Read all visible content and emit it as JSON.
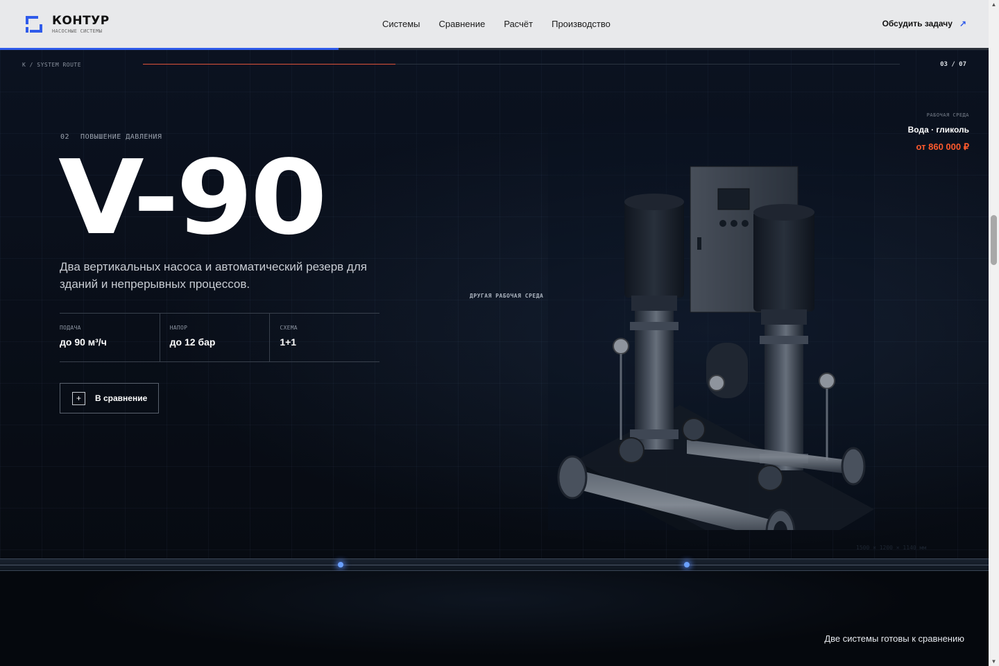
{
  "header": {
    "brand": "КОНТУР",
    "brand_sub": "НАСОСНЫЕ СИСТЕМЫ",
    "nav": [
      "Системы",
      "Сравнение",
      "Расчёт",
      "Производство"
    ],
    "cta_label": "Обсудить задачу",
    "cta_icon": "arrow-up-right-icon",
    "scroll_progress": 0.34,
    "accent": "#2f5bea"
  },
  "route": {
    "label": "K / SYSTEM ROUTE",
    "counter": "03 / 07",
    "accent": "#e0543a"
  },
  "hero": {
    "index": "02",
    "category": "ПОВЫШЕНИЕ ДАВЛЕНИЯ",
    "title": "V-90",
    "lead": "Два вертикальных насоса и автоматический резерв для зданий и непрерывных процессов.",
    "specs": [
      {
        "label": "ПОДАЧА",
        "value": "до 90 м³/ч"
      },
      {
        "label": "НАПОР",
        "value": "до 12 бар"
      },
      {
        "label": "СХЕМА",
        "value": "1+1"
      }
    ],
    "compare_button": "В сравнение",
    "env_center_label": "ДРУГАЯ РАБОЧАЯ СРЕДА",
    "env_caption": "РАБОЧАЯ СРЕДА",
    "env_value": "Вода · гликоль",
    "price": "от 860 000 ₽",
    "price_color": "#ff5a2c",
    "dimensions": "1500 × 1200 × 1140 мм"
  },
  "bottom": {
    "ready_text": "Две системы готовы к сравнению"
  }
}
